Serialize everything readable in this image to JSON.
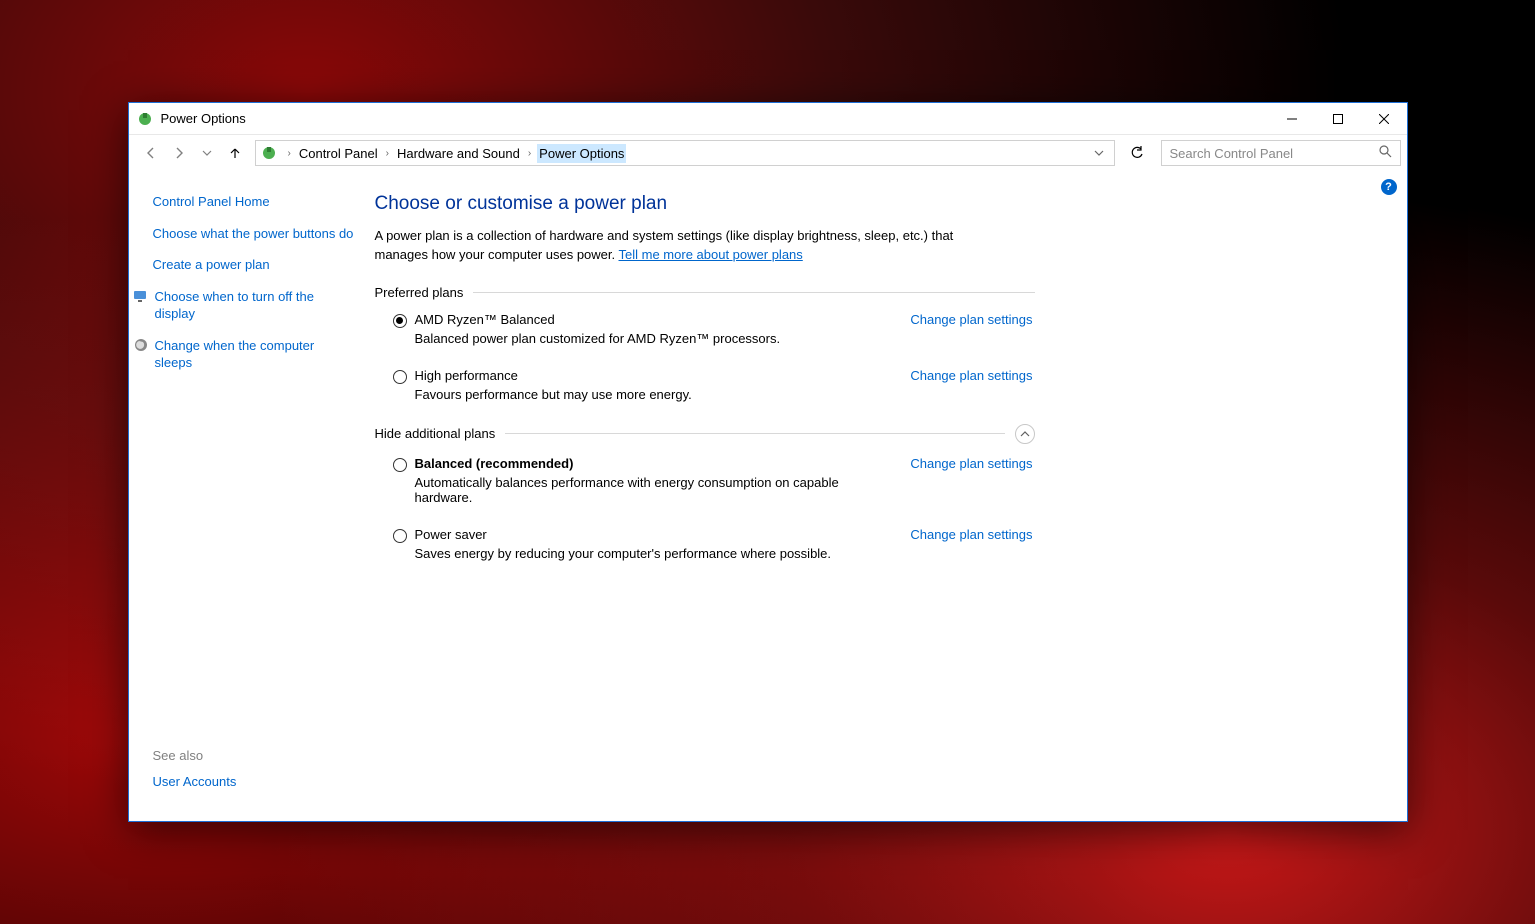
{
  "titlebar": {
    "title": "Power Options"
  },
  "breadcrumb": {
    "items": [
      "Control Panel",
      "Hardware and Sound",
      "Power Options"
    ]
  },
  "search": {
    "placeholder": "Search Control Panel"
  },
  "sidebar": {
    "home": "Control Panel Home",
    "links": [
      "Choose what the power buttons do",
      "Create a power plan",
      "Choose when to turn off the display",
      "Change when the computer sleeps"
    ],
    "see_also_label": "See also",
    "see_also_links": [
      "User Accounts"
    ]
  },
  "main": {
    "heading": "Choose or customise a power plan",
    "intro_text": "A power plan is a collection of hardware and system settings (like display brightness, sleep, etc.) that manages how your computer uses power. ",
    "intro_link": "Tell me more about power plans",
    "preferred_label": "Preferred plans",
    "hide_label": "Hide additional plans",
    "change_label": "Change plan settings",
    "plans_preferred": [
      {
        "name": "AMD Ryzen™ Balanced",
        "desc": "Balanced power plan customized for AMD Ryzen™ processors.",
        "selected": true,
        "bold": false
      },
      {
        "name": "High performance",
        "desc": "Favours performance but may use more energy.",
        "selected": false,
        "bold": false
      }
    ],
    "plans_additional": [
      {
        "name": "Balanced (recommended)",
        "desc": "Automatically balances performance with energy consumption on capable hardware.",
        "selected": false,
        "bold": true
      },
      {
        "name": "Power saver",
        "desc": "Saves energy by reducing your computer's performance where possible.",
        "selected": false,
        "bold": false
      }
    ]
  }
}
